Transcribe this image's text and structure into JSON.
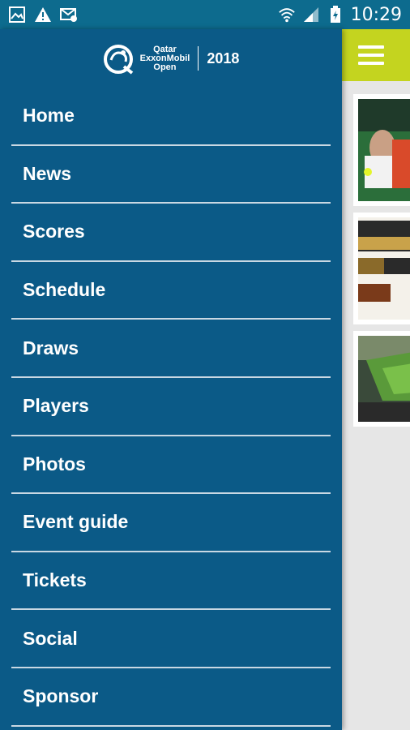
{
  "status_bar": {
    "icons_left": [
      "gallery-icon",
      "warning-icon",
      "email-sync-icon"
    ],
    "icons_right": [
      "wifi-icon",
      "signal-icon",
      "battery-icon"
    ],
    "time": "10:29"
  },
  "brand": {
    "logo_line1": "Qatar",
    "logo_line2": "ExxonMobil",
    "logo_line3": "Open",
    "year": "2018"
  },
  "menu": [
    {
      "label": "Home"
    },
    {
      "label": "News"
    },
    {
      "label": "Scores"
    },
    {
      "label": "Schedule"
    },
    {
      "label": "Draws"
    },
    {
      "label": "Players"
    },
    {
      "label": "Photos"
    },
    {
      "label": "Event guide"
    },
    {
      "label": "Tickets"
    },
    {
      "label": "Social"
    },
    {
      "label": "Sponsor"
    }
  ],
  "colors": {
    "status_bar": "#0d6b8e",
    "drawer": "#0b5a87",
    "top_bar": "#c4d41f"
  }
}
